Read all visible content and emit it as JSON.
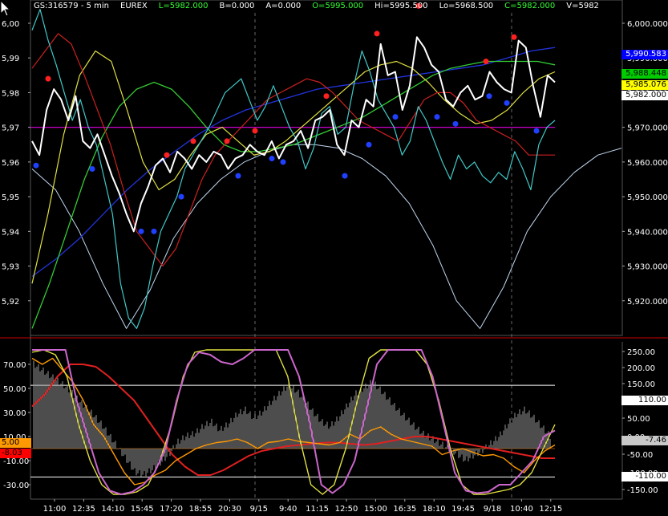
{
  "header": {
    "symbol": "GS:316579 - 5 min",
    "exchange": "EUREX",
    "last": "L=5982.000",
    "bid": "B=0.000",
    "ask": "A=0.000",
    "open": "O=5995.000",
    "high": "Hi=5995.500",
    "low": "Lo=5968.500",
    "close": "C=5982.000",
    "volume": "V=5982"
  },
  "colors": {
    "bg": "#000000",
    "price": "#ffffff",
    "cyan": "#40c8c8",
    "red": "#cc2020",
    "green": "#33cc33",
    "yellow": "#e0e040",
    "blue": "#2233dd",
    "magenta": "#cc00cc",
    "arc": "#c0d8f0",
    "orange": "#ff9900",
    "separator": "#cc0000"
  },
  "price_tags": [
    {
      "label": "5,990.583",
      "bg": "#0000ff",
      "fg": "#ffffff"
    },
    {
      "label": "5,988.448",
      "bg": "#00cc00",
      "fg": "#000000"
    },
    {
      "label": "5,985.076",
      "bg": "#ffff00",
      "fg": "#000000"
    },
    {
      "label": "5,982.000",
      "bg": "#ffffff",
      "fg": "#000000"
    }
  ],
  "osc_tags": {
    "right": [
      {
        "label": "110.00",
        "bg": "#ffffff",
        "fg": "#000000"
      },
      {
        "label": "-7.46",
        "bg": "#c8c8c8",
        "fg": "#000000"
      },
      {
        "label": "-110.00",
        "bg": "#ffffff",
        "fg": "#000000"
      }
    ],
    "left": [
      {
        "label": "5.00",
        "bg": "#ff9900",
        "fg": "#000000"
      },
      {
        "label": "-8.03",
        "bg": "#ff0000",
        "fg": "#000000"
      }
    ]
  },
  "chart_data": [
    {
      "type": "line",
      "name": "price-panel",
      "x": [
        "11:00",
        "12:35",
        "14:10",
        "15:45",
        "17:20",
        "18:55",
        "20:30",
        "9/15",
        "9:40",
        "11:15",
        "12:50",
        "15:00",
        "16:35",
        "18:10",
        "19:45",
        "9/18",
        "10:40",
        "12:15"
      ],
      "left_ticks": [
        "6,00",
        "5,99",
        "5,98",
        "5,97",
        "5,96",
        "5,95",
        "5,94",
        "5,93",
        "5,92"
      ],
      "right_ticks": [
        "6,000.000",
        "5,990.000",
        "5,980.000",
        "5,970.000",
        "5,960.000",
        "5,950.000",
        "5,940.000",
        "5,930.000",
        "5,920.000"
      ],
      "ylim": [
        5910,
        6003
      ],
      "horizontal_line": 5970,
      "series": [
        {
          "role": "price",
          "color": "#ffffff",
          "values": [
            5966,
            5962,
            5975,
            5981,
            5978,
            5972,
            5979,
            5966,
            5964,
            5968,
            5962,
            5956,
            5951,
            5945,
            5940,
            5948,
            5953,
            5959,
            5961,
            5957,
            5963,
            5961,
            5958,
            5962,
            5960,
            5963,
            5962,
            5958,
            5961,
            5962,
            5965,
            5963,
            5962,
            5966,
            5961,
            5965,
            5966,
            5969,
            5964,
            5972,
            5973,
            5975,
            5965,
            5962,
            5972,
            5970,
            5978,
            5976,
            5994,
            5985,
            5986,
            5975,
            5982,
            5996,
            5993,
            5988,
            5986,
            5978,
            5976,
            5980,
            5982,
            5978,
            5979,
            5986,
            5983,
            5981,
            5980,
            5995,
            5993,
            5982,
            5973,
            5985,
            5983
          ]
        },
        {
          "role": "cyan-osc",
          "color": "#40c8c8",
          "values": [
            5998,
            6004,
            5995,
            5988,
            5980,
            5972,
            5978,
            5970,
            5965,
            5955,
            5945,
            5925,
            5915,
            5912,
            5918,
            5930,
            5940,
            5945,
            5950,
            5958,
            5962,
            5966,
            5970,
            5975,
            5980,
            5982,
            5984,
            5978,
            5972,
            5976,
            5982,
            5976,
            5970,
            5966,
            5958,
            5964,
            5974,
            5976,
            5968,
            5970,
            5982,
            5992,
            5986,
            5978,
            5974,
            5970,
            5962,
            5966,
            5976,
            5972,
            5966,
            5960,
            5955,
            5962,
            5958,
            5960,
            5956,
            5954,
            5957,
            5955,
            5963,
            5958,
            5952,
            5965,
            5970,
            5972
          ]
        },
        {
          "role": "red-ma",
          "color": "#cc2020",
          "values": [
            5987,
            5992,
            5997,
            5994,
            5985,
            5975,
            5965,
            5952,
            5940,
            5935,
            5930,
            5935,
            5945,
            5955,
            5962,
            5966,
            5970,
            5974,
            5978,
            5980,
            5982,
            5984,
            5983,
            5980,
            5976,
            5972,
            5970,
            5968,
            5966,
            5972,
            5978,
            5980,
            5980,
            5977,
            5972,
            5970,
            5968,
            5966,
            5962,
            5962,
            5962
          ]
        },
        {
          "role": "yellow-cycle",
          "color": "#e0e040",
          "values": [
            5925,
            5945,
            5968,
            5985,
            5992,
            5989,
            5975,
            5960,
            5952,
            5955,
            5962,
            5968,
            5970,
            5966,
            5962,
            5963,
            5966,
            5970,
            5974,
            5978,
            5982,
            5986,
            5988,
            5989,
            5987,
            5983,
            5978,
            5974,
            5971,
            5972,
            5975,
            5980,
            5984,
            5986
          ]
        },
        {
          "role": "green-ma",
          "color": "#33cc33",
          "values": [
            5912,
            5925,
            5940,
            5955,
            5967,
            5976,
            5981,
            5983,
            5981,
            5976,
            5970,
            5965,
            5963,
            5963,
            5964,
            5965,
            5967,
            5969,
            5971,
            5973,
            5976,
            5979,
            5982,
            5985,
            5987,
            5988,
            5989,
            5989,
            5989,
            5989,
            5988
          ]
        },
        {
          "role": "blue-ma",
          "color": "#2233dd",
          "values": [
            5927,
            5932,
            5938,
            5945,
            5952,
            5958,
            5963,
            5968,
            5972,
            5975,
            5977,
            5979,
            5981,
            5982,
            5983,
            5984,
            5985,
            5986,
            5987,
            5988,
            5990,
            5992,
            5993
          ]
        },
        {
          "role": "arc",
          "color": "#c0d8f0",
          "values": [
            5958,
            5952,
            5940,
            5925,
            5912,
            5923,
            5938,
            5948,
            5955,
            5960,
            5963,
            5965,
            5965,
            5964,
            5961,
            5956,
            5948,
            5936,
            5920,
            5912,
            5924,
            5940,
            5950,
            5957,
            5962,
            5964
          ]
        }
      ],
      "markers": {
        "red": [
          [
            60,
            5984
          ],
          [
            208,
            5962
          ],
          [
            241,
            5966
          ],
          [
            283,
            5966
          ],
          [
            318,
            5969
          ],
          [
            407,
            5979
          ],
          [
            470,
            5997
          ],
          [
            522,
            6005
          ],
          [
            606,
            5989
          ],
          [
            641,
            5996
          ]
        ],
        "blue": [
          [
            45,
            5959
          ],
          [
            115,
            5958
          ],
          [
            176,
            5940
          ],
          [
            192,
            5940
          ],
          [
            226,
            5950
          ],
          [
            297,
            5956
          ],
          [
            339,
            5961
          ],
          [
            353,
            5960
          ],
          [
            430,
            5956
          ],
          [
            460,
            5965
          ],
          [
            493,
            5973
          ],
          [
            545,
            5973
          ],
          [
            568,
            5971
          ],
          [
            610,
            5979
          ],
          [
            632,
            5977
          ],
          [
            669,
            5969
          ]
        ]
      }
    },
    {
      "type": "line",
      "name": "oscillator-panel",
      "left_ticks": [
        "70.00",
        "50.00",
        "30.00",
        "10.00",
        "-10.00",
        "-30.00"
      ],
      "right_ticks": [
        "250.00",
        "200.00",
        "150.00",
        "100.00",
        "50.00",
        "0.00",
        "-50.00",
        "-100.00",
        "-150.00"
      ],
      "ylim": [
        -42,
        86
      ],
      "levels": [
        52.6,
        -23.6
      ],
      "series": [
        {
          "role": "magenta-stoch",
          "color": "#cc66cc",
          "values": [
            82,
            82,
            82,
            82,
            40,
            10,
            -20,
            -35,
            -38,
            -36,
            -30,
            -20,
            0,
            40,
            70,
            80,
            78,
            72,
            70,
            75,
            82,
            82,
            82,
            82,
            60,
            20,
            -30,
            -37,
            -30,
            -10,
            30,
            70,
            82,
            82,
            82,
            82,
            60,
            20,
            -20,
            -35,
            -37,
            -36,
            -30,
            -30,
            -20,
            -10,
            10,
            15
          ]
        },
        {
          "role": "yellow-stoch",
          "color": "#e0e040",
          "values": [
            80,
            82,
            78,
            60,
            20,
            -10,
            -30,
            -38,
            -38,
            -36,
            -30,
            -10,
            20,
            60,
            80,
            82,
            82,
            82,
            82,
            82,
            82,
            82,
            60,
            10,
            -30,
            -38,
            -30,
            0,
            40,
            75,
            82,
            82,
            82,
            82,
            70,
            40,
            0,
            -30,
            -38,
            -38,
            -36,
            -34,
            -30,
            -20,
            0,
            20
          ]
        },
        {
          "role": "orange-line",
          "color": "#ff9900",
          "values": [
            75,
            70,
            75,
            65,
            55,
            40,
            20,
            10,
            -5,
            -20,
            -30,
            -28,
            -22,
            -18,
            -10,
            -5,
            0,
            3,
            5,
            6,
            8,
            5,
            0,
            5,
            6,
            8,
            6,
            5,
            4,
            3,
            5,
            12,
            8,
            15,
            18,
            12,
            8,
            6,
            4,
            2,
            -5,
            -2,
            0,
            -3,
            -6,
            -5,
            -8,
            -15,
            -20,
            -10,
            -2,
            3
          ]
        },
        {
          "role": "red-line",
          "color": "#e02020",
          "values": [
            35,
            45,
            60,
            70,
            70,
            68,
            60,
            50,
            40,
            25,
            10,
            -5,
            -15,
            -22,
            -22,
            -18,
            -12,
            -6,
            -2,
            0,
            2,
            3,
            4,
            5,
            5,
            4,
            3,
            4,
            6,
            8,
            10,
            10,
            8,
            6,
            4,
            2,
            0,
            -2,
            -4,
            -6,
            -8,
            -8
          ]
        },
        {
          "role": "histogram",
          "color": "#aaaaaa",
          "values": [
            70,
            65,
            60,
            55,
            50,
            42,
            35,
            28,
            20,
            10,
            0,
            -10,
            -20,
            -22,
            -18,
            -12,
            -5,
            5,
            10,
            12,
            18,
            22,
            15,
            20,
            28,
            32,
            25,
            30,
            38,
            45,
            52,
            48,
            40,
            30,
            22,
            18,
            25,
            35,
            45,
            50,
            55,
            48,
            40,
            32,
            25,
            18,
            12,
            8,
            4,
            0,
            -5,
            -10,
            -6,
            -2,
            4,
            10,
            20,
            28,
            32,
            26,
            18,
            10
          ]
        }
      ]
    }
  ]
}
